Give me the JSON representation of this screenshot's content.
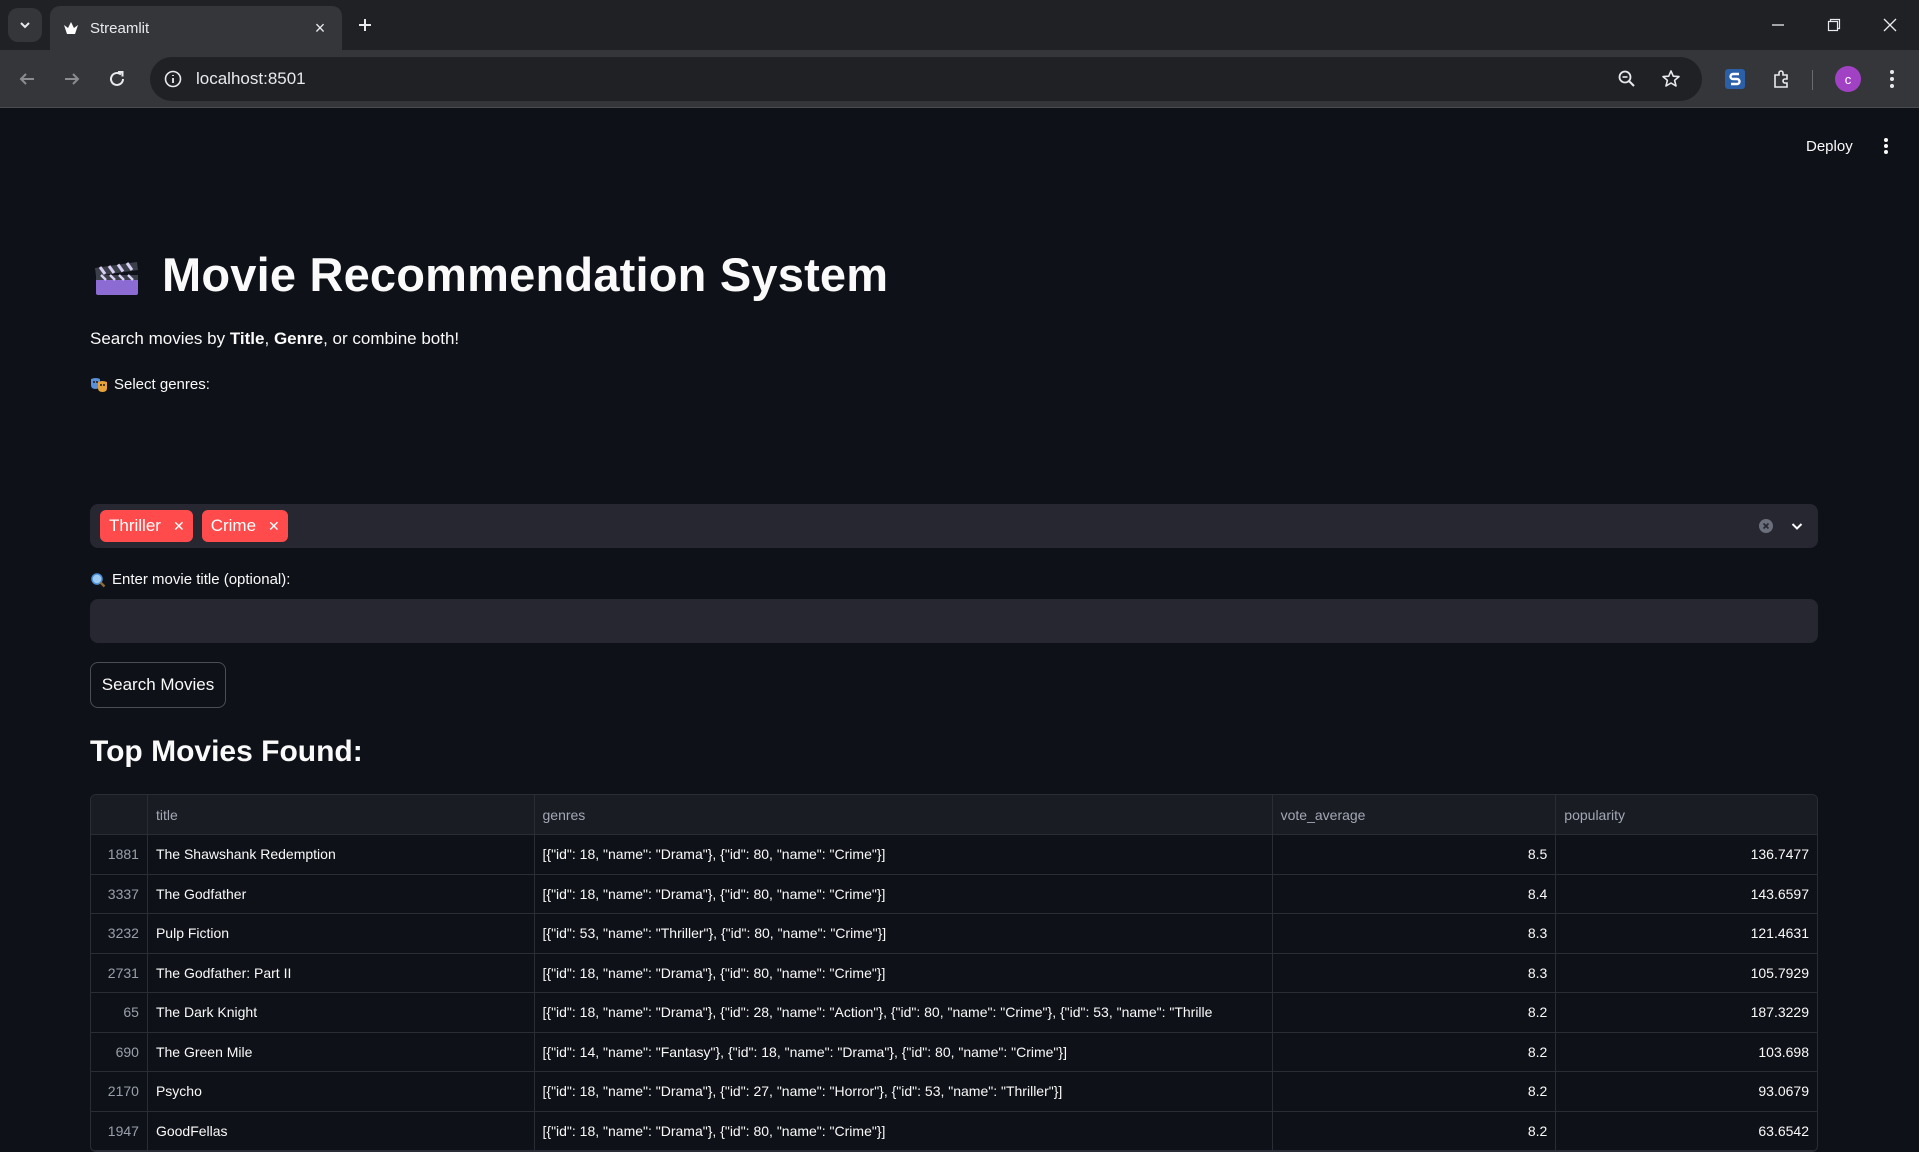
{
  "browser": {
    "tab_title": "Streamlit",
    "url": "localhost:8501",
    "avatar_initial": "c"
  },
  "app": {
    "deploy_label": "Deploy",
    "title": "Movie Recommendation System",
    "subtitle_prefix": "Search movies by ",
    "subtitle_bold1": "Title",
    "subtitle_sep": ", ",
    "subtitle_bold2": "Genre",
    "subtitle_suffix": ", or combine both!",
    "genres_label": "Select genres:",
    "selected_genres": [
      "Thriller",
      "Crime"
    ],
    "title_input_label": "Enter movie title (optional):",
    "title_input_value": "",
    "search_button": "Search Movies",
    "results_heading": "Top Movies Found:"
  },
  "table": {
    "columns": [
      "",
      "title",
      "genres",
      "vote_average",
      "popularity"
    ],
    "rows": [
      {
        "idx": "1881",
        "title": "The Shawshank Redemption",
        "genres": "[{\"id\": 18, \"name\": \"Drama\"}, {\"id\": 80, \"name\": \"Crime\"}]",
        "vote": "8.5",
        "pop": "136.7477"
      },
      {
        "idx": "3337",
        "title": "The Godfather",
        "genres": "[{\"id\": 18, \"name\": \"Drama\"}, {\"id\": 80, \"name\": \"Crime\"}]",
        "vote": "8.4",
        "pop": "143.6597"
      },
      {
        "idx": "3232",
        "title": "Pulp Fiction",
        "genres": "[{\"id\": 53, \"name\": \"Thriller\"}, {\"id\": 80, \"name\": \"Crime\"}]",
        "vote": "8.3",
        "pop": "121.4631"
      },
      {
        "idx": "2731",
        "title": "The Godfather: Part II",
        "genres": "[{\"id\": 18, \"name\": \"Drama\"}, {\"id\": 80, \"name\": \"Crime\"}]",
        "vote": "8.3",
        "pop": "105.7929"
      },
      {
        "idx": "65",
        "title": "The Dark Knight",
        "genres": "[{\"id\": 18, \"name\": \"Drama\"}, {\"id\": 28, \"name\": \"Action\"}, {\"id\": 80, \"name\": \"Crime\"}, {\"id\": 53, \"name\": \"Thrille",
        "vote": "8.2",
        "pop": "187.3229"
      },
      {
        "idx": "690",
        "title": "The Green Mile",
        "genres": "[{\"id\": 14, \"name\": \"Fantasy\"}, {\"id\": 18, \"name\": \"Drama\"}, {\"id\": 80, \"name\": \"Crime\"}]",
        "vote": "8.2",
        "pop": "103.698"
      },
      {
        "idx": "2170",
        "title": "Psycho",
        "genres": "[{\"id\": 18, \"name\": \"Drama\"}, {\"id\": 27, \"name\": \"Horror\"}, {\"id\": 53, \"name\": \"Thriller\"}]",
        "vote": "8.2",
        "pop": "93.0679"
      },
      {
        "idx": "1947",
        "title": "GoodFellas",
        "genres": "[{\"id\": 18, \"name\": \"Drama\"}, {\"id\": 80, \"name\": \"Crime\"}]",
        "vote": "8.2",
        "pop": "63.6542"
      }
    ]
  },
  "colors": {
    "accent": "#ff4b4b",
    "background": "#0e1117",
    "input_bg": "#262730"
  },
  "icons": {
    "title_emoji": "clapper-board-icon",
    "genres_label_icon": "performing-arts-icon",
    "title_label_icon": "magnifier-icon"
  }
}
